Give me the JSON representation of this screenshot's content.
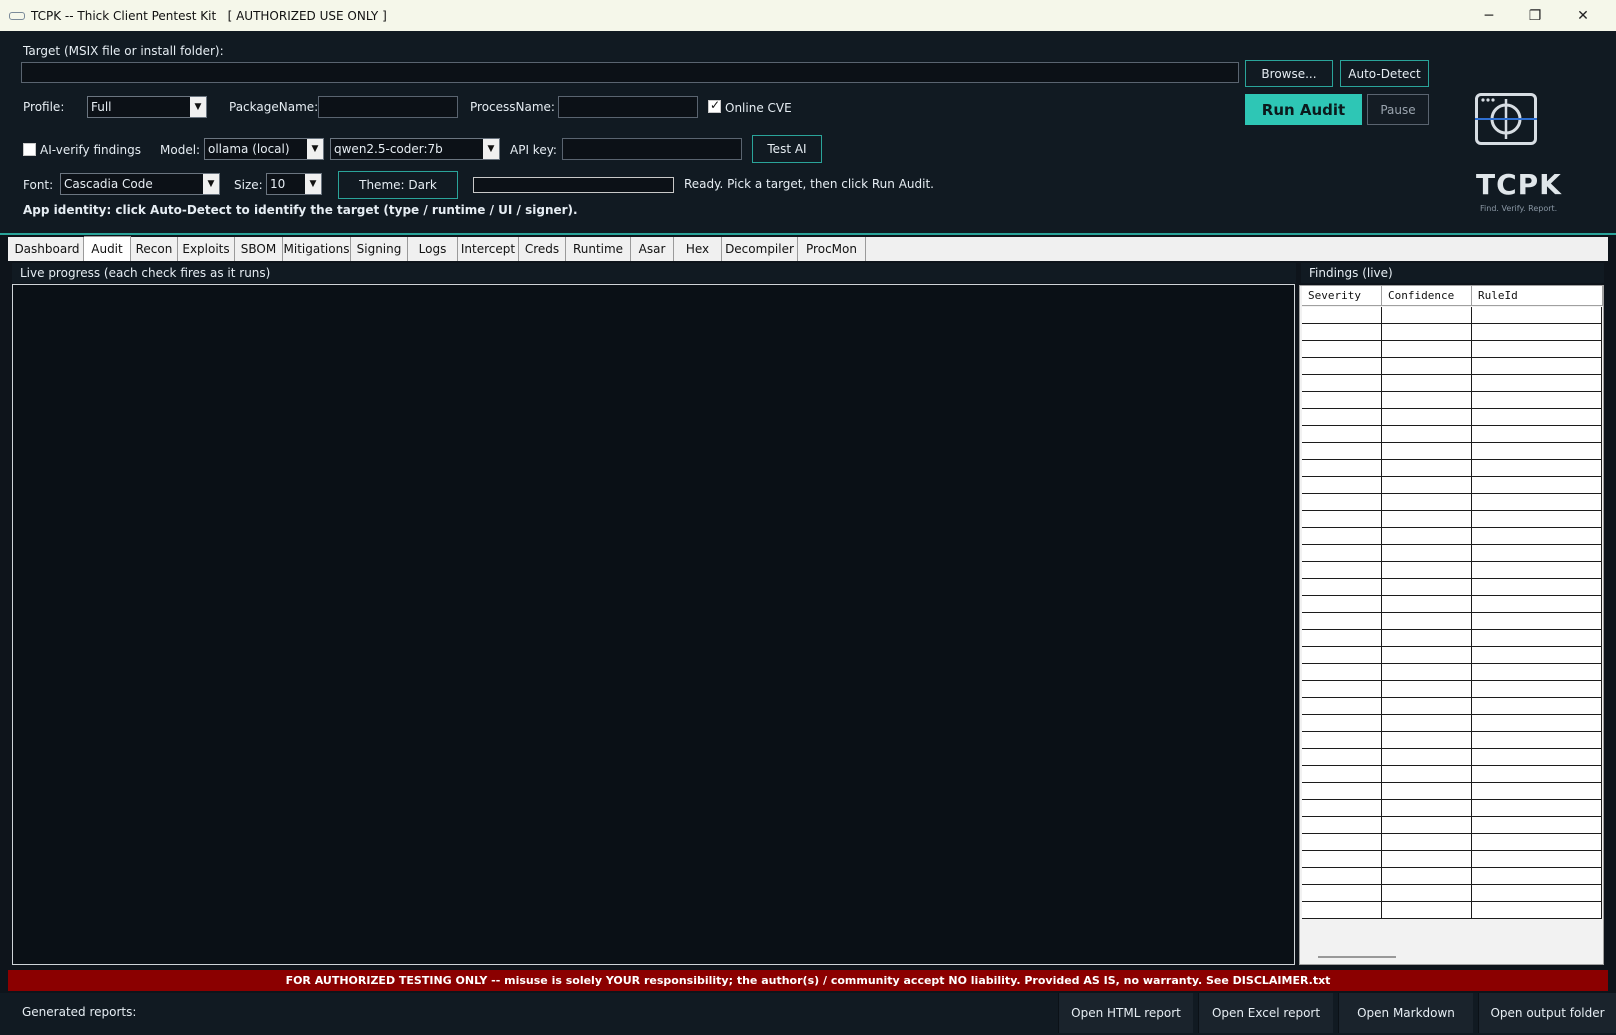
{
  "window": {
    "title": "TCPK -- Thick Client Pentest Kit   [ AUTHORIZED USE ONLY ]",
    "minimize_glyph": "─",
    "restore_glyph": "❐",
    "close_glyph": "✕"
  },
  "target": {
    "label": "Target (MSIX file or install folder):",
    "value": "",
    "browse_label": "Browse...",
    "autodetect_label": "Auto-Detect"
  },
  "profile": {
    "label": "Profile:",
    "value": "Full",
    "package_label": "PackageName:",
    "package_value": "",
    "process_label": "ProcessName:",
    "process_value": "",
    "online_cve_label": "Online CVE",
    "online_cve_checked": true
  },
  "actions": {
    "run_audit": "Run Audit",
    "pause": "Pause"
  },
  "ai": {
    "verify_label": "AI-verify findings",
    "verify_checked": false,
    "model_label": "Model:",
    "model_provider": "ollama (local)",
    "model_name": "qwen2.5-coder:7b",
    "api_key_label": "API key:",
    "api_key_value": "",
    "test_label": "Test AI"
  },
  "appearance": {
    "font_label": "Font:",
    "font_value": "Cascadia Code",
    "size_label": "Size:",
    "size_value": "10",
    "theme_label": "Theme: Dark",
    "progress_value": 0,
    "status_text": "Ready. Pick a target, then click Run Audit."
  },
  "identity_hint": "App identity: click Auto-Detect to identify the target (type / runtime / UI / signer).",
  "logo": {
    "name": "TCPK",
    "tagline": "Find. Verify. Report."
  },
  "tabs": [
    {
      "label": "Dashboard",
      "active": false
    },
    {
      "label": "Audit",
      "active": true
    },
    {
      "label": "Recon",
      "active": false
    },
    {
      "label": "Exploits",
      "active": false
    },
    {
      "label": "SBOM",
      "active": false
    },
    {
      "label": "Mitigations",
      "active": false
    },
    {
      "label": "Signing",
      "active": false
    },
    {
      "label": "Logs",
      "active": false
    },
    {
      "label": "Intercept",
      "active": false
    },
    {
      "label": "Creds",
      "active": false
    },
    {
      "label": "Runtime",
      "active": false
    },
    {
      "label": "Asar",
      "active": false
    },
    {
      "label": "Hex",
      "active": false
    },
    {
      "label": "Decompiler",
      "active": false
    },
    {
      "label": "ProcMon",
      "active": false
    }
  ],
  "progress_panel": {
    "title": "Live progress (each check fires as it runs)"
  },
  "findings": {
    "title": "Findings (live)",
    "columns": [
      "Severity",
      "Confidence",
      "RuleId"
    ],
    "rows": []
  },
  "disclaimer": "FOR AUTHORIZED TESTING ONLY  --  misuse is solely YOUR responsibility; the author(s) / community accept NO liability.  Provided AS IS, no warranty.  See DISCLAIMER.txt",
  "footer": {
    "label": "Generated reports:",
    "buttons": [
      "Open HTML report",
      "Open Excel report",
      "Open Markdown",
      "Open output folder"
    ]
  },
  "colors": {
    "accent": "#2ec6b5",
    "background": "#0e141b",
    "warning": "#8b0000"
  }
}
